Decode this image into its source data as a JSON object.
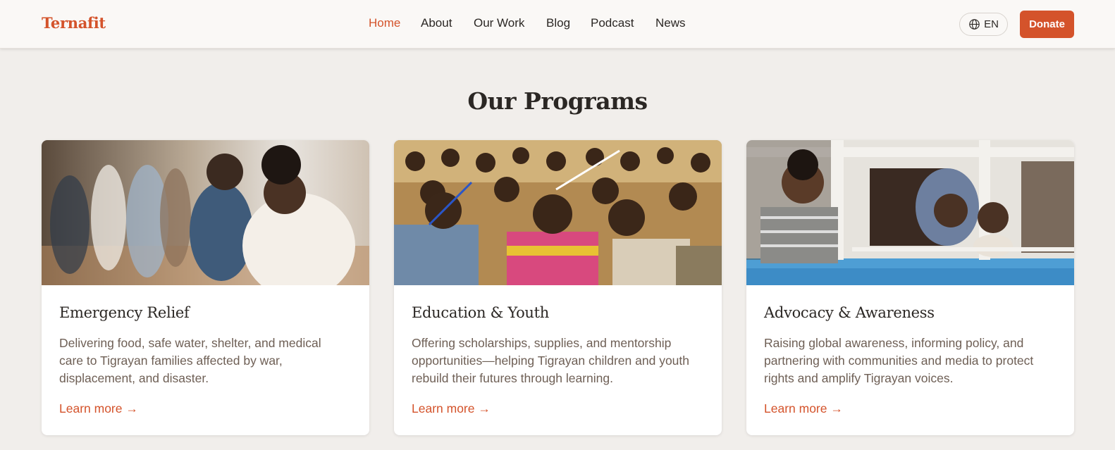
{
  "header": {
    "logo": "Ternafit",
    "nav": [
      "Home",
      "About",
      "Our Work",
      "Blog",
      "Podcast",
      "News"
    ],
    "active_nav": "Home",
    "lang_label": "EN",
    "donate_label": "Donate"
  },
  "programs": {
    "title": "Our Programs",
    "cards": [
      {
        "title": "Emergency Relief",
        "description": "Delivering food, safe water, shelter, and medical care to Tigrayan families affected by war, displacement, and disaster.",
        "link": "Learn more →"
      },
      {
        "title": "Education & Youth",
        "description": "Offering scholarships, supplies, and mentorship opportunities—helping Tigrayan children and youth rebuild their futures through learning.",
        "link": "Learn more →"
      },
      {
        "title": "Advocacy & Awareness",
        "description": "Raising global awareness, informing policy, and partnering with communities and media to protect rights and amplify Tigrayan voices.",
        "link": "Learn more →"
      }
    ]
  },
  "colors": {
    "accent": "#d4532b",
    "background": "#f1eeeb",
    "header_bg": "#faf8f6",
    "body_text": "#6e5f55"
  },
  "icons": {
    "language": "globe-icon"
  }
}
